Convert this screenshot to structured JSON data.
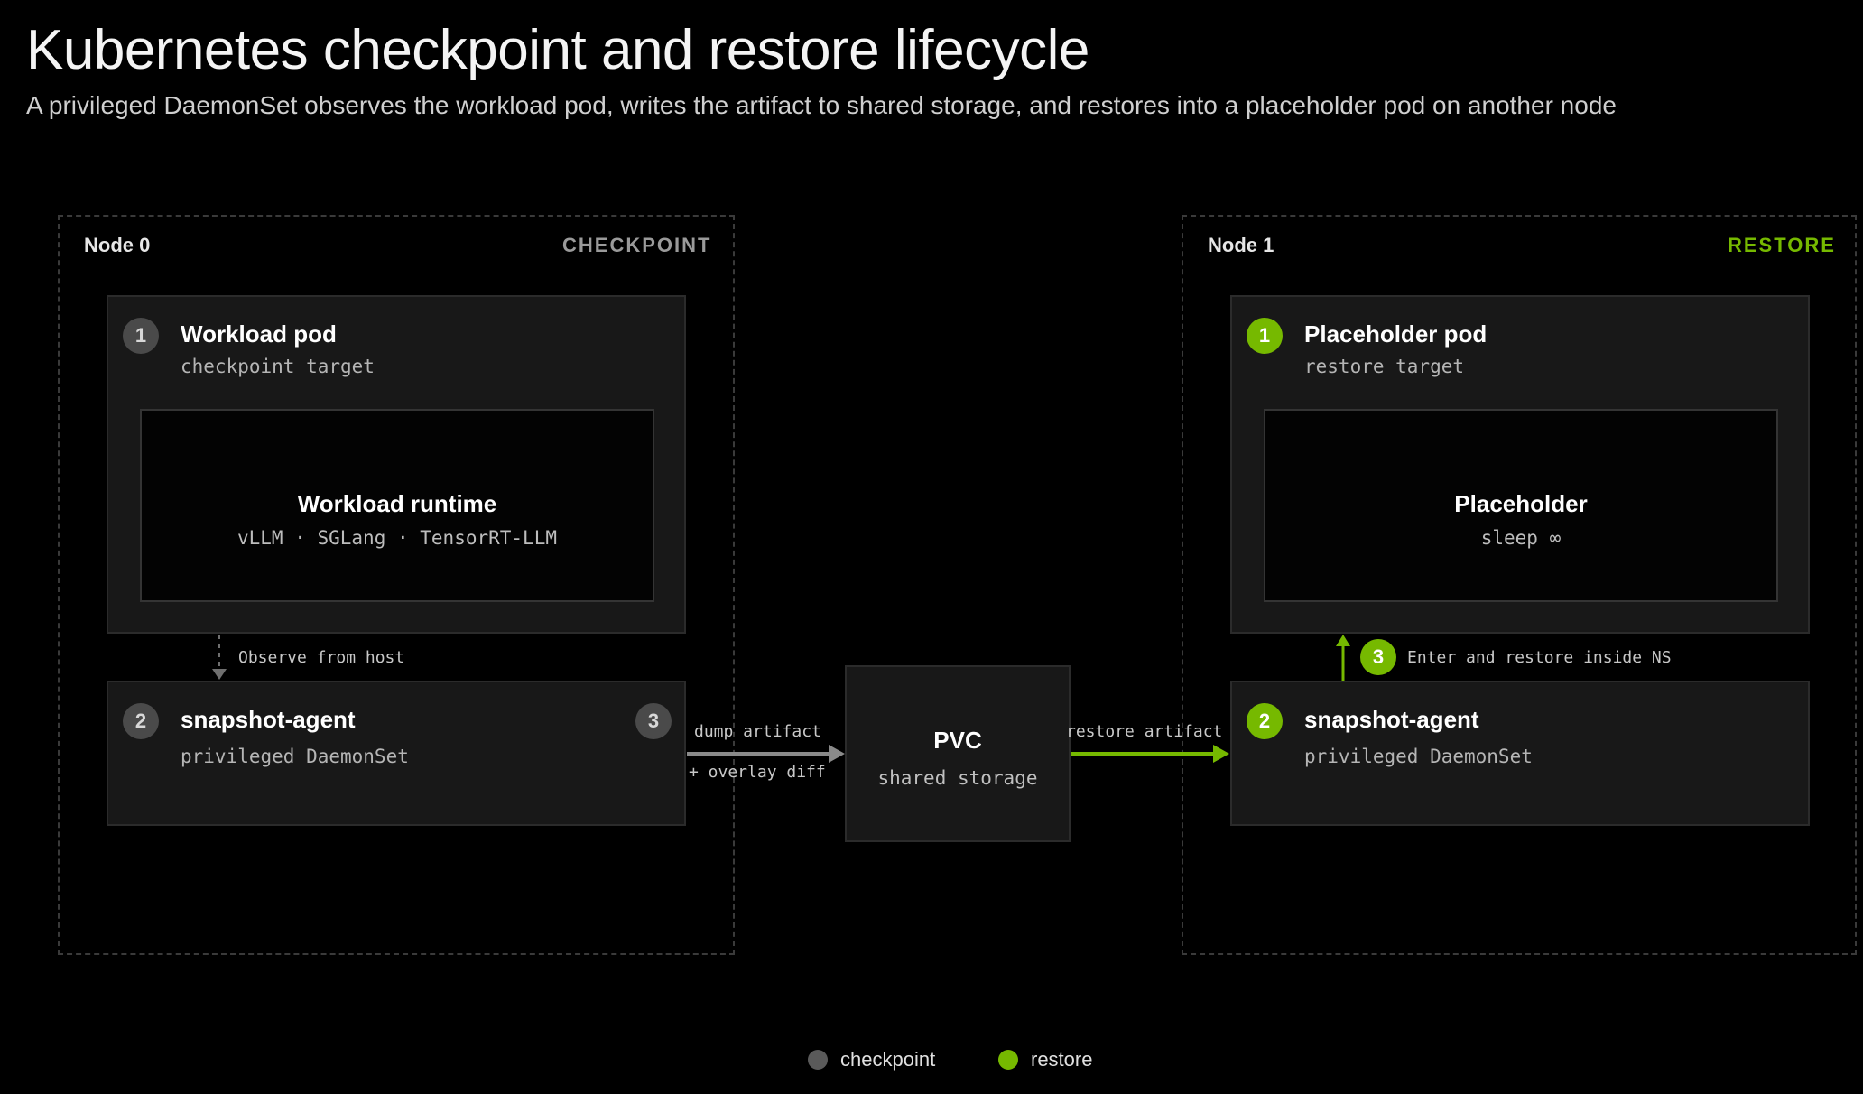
{
  "title": "Kubernetes checkpoint and restore lifecycle",
  "subtitle": "A privileged DaemonSet observes the workload pod, writes the artifact to shared storage, and restores into a placeholder pod on another node",
  "colors": {
    "checkpoint": "#5a5a5a",
    "restore": "#76b900",
    "arrow_gray": "#8a8a8a"
  },
  "node0": {
    "label": "Node 0",
    "phase": "CHECKPOINT",
    "workload_pod": {
      "step": "1",
      "title": "Workload pod",
      "subtitle": "checkpoint target",
      "runtime_title": "Workload runtime",
      "runtime_sub": "vLLM · SGLang · TensorRT-LLM"
    },
    "observe_label": "Observe from host",
    "agent": {
      "step": "2",
      "title": "snapshot-agent",
      "subtitle": "privileged DaemonSet",
      "dump_step": "3"
    }
  },
  "dump_label": "dump artifact",
  "overlay_label": "+ overlay diff",
  "pvc": {
    "title": "PVC",
    "subtitle": "shared storage"
  },
  "restore_label": "restore artifact",
  "node1": {
    "label": "Node 1",
    "phase": "RESTORE",
    "placeholder_pod": {
      "step": "1",
      "title": "Placeholder pod",
      "subtitle": "restore target",
      "inner_title": "Placeholder",
      "inner_sub": "sleep ∞"
    },
    "enter_step": "3",
    "enter_label": "Enter and restore inside NS",
    "agent": {
      "step": "2",
      "title": "snapshot-agent",
      "subtitle": "privileged DaemonSet"
    }
  },
  "legend": [
    {
      "label": "checkpoint",
      "color": "#5a5a5a"
    },
    {
      "label": "restore",
      "color": "#76b900"
    }
  ]
}
